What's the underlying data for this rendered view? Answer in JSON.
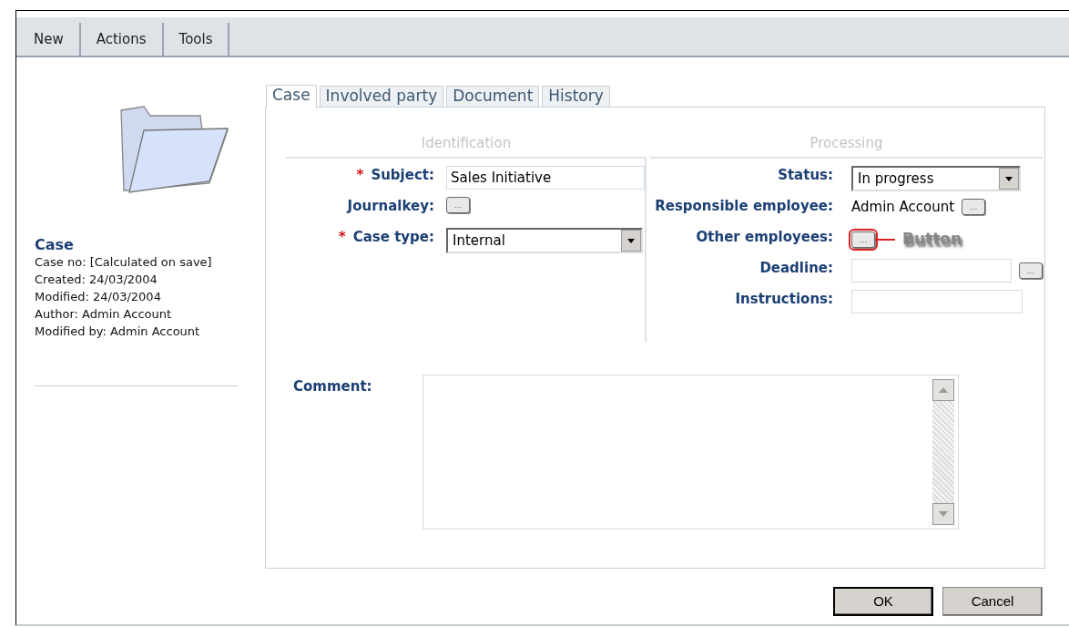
{
  "toolbar": {
    "items": [
      {
        "label": "New"
      },
      {
        "label": "Actions"
      },
      {
        "label": "Tools"
      }
    ]
  },
  "summary": {
    "title": "Case",
    "lines": [
      "Case no: [Calculated on save]",
      "Created: 24/03/2004",
      "Modified: 24/03/2004",
      "Author: Admin Account",
      "Modified by: Admin Account"
    ]
  },
  "tabs": [
    {
      "label": "Case",
      "selected": true
    },
    {
      "label": "Involved party",
      "selected": false
    },
    {
      "label": "Document",
      "selected": false
    },
    {
      "label": "History",
      "selected": false
    }
  ],
  "sections": [
    {
      "title": "Identification",
      "fields": [
        {
          "label": "Subject:",
          "required": true,
          "kind": "text",
          "value": "Sales Initiative"
        },
        {
          "label": "Journalkey:",
          "required": false,
          "kind": "lookup",
          "button": "..."
        },
        {
          "label": "Case type:",
          "required": true,
          "kind": "select",
          "value": "Internal"
        }
      ]
    },
    {
      "title": "Processing",
      "fields": [
        {
          "label": "Status:",
          "required": false,
          "kind": "select",
          "value": "In progress"
        },
        {
          "label": "Responsible employee:",
          "required": false,
          "kind": "static",
          "value": "Admin Account",
          "button": "..."
        },
        {
          "label": "Other employees:",
          "required": false,
          "kind": "lookup",
          "button": "...",
          "highlighted": true,
          "callout": "Button"
        },
        {
          "label": "Deadline:",
          "required": false,
          "kind": "text",
          "button": "..."
        },
        {
          "label": "Instructions:",
          "required": false,
          "kind": "text"
        }
      ]
    }
  ],
  "required_mark": "*",
  "comment": {
    "label": "Comment:"
  },
  "buttons": [
    {
      "label": "OK",
      "default": true
    },
    {
      "label": "Cancel",
      "default": false
    }
  ]
}
